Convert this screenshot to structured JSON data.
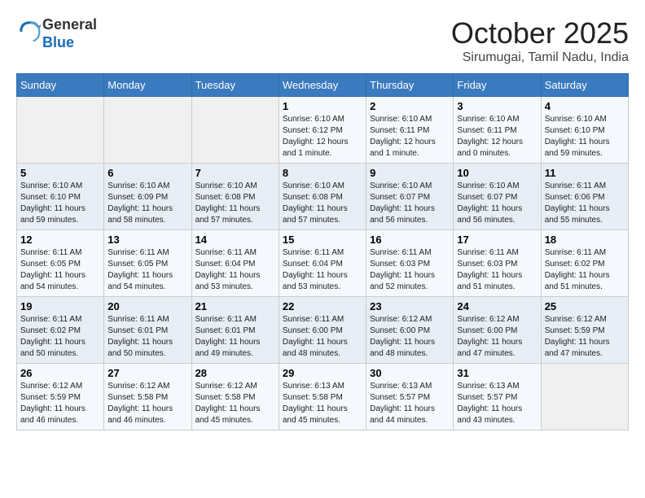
{
  "header": {
    "logo_line1": "General",
    "logo_line2": "Blue",
    "month": "October 2025",
    "location": "Sirumugai, Tamil Nadu, India"
  },
  "weekdays": [
    "Sunday",
    "Monday",
    "Tuesday",
    "Wednesday",
    "Thursday",
    "Friday",
    "Saturday"
  ],
  "weeks": [
    [
      {
        "day": "",
        "info": ""
      },
      {
        "day": "",
        "info": ""
      },
      {
        "day": "",
        "info": ""
      },
      {
        "day": "1",
        "info": "Sunrise: 6:10 AM\nSunset: 6:12 PM\nDaylight: 12 hours\nand 1 minute."
      },
      {
        "day": "2",
        "info": "Sunrise: 6:10 AM\nSunset: 6:11 PM\nDaylight: 12 hours\nand 1 minute."
      },
      {
        "day": "3",
        "info": "Sunrise: 6:10 AM\nSunset: 6:11 PM\nDaylight: 12 hours\nand 0 minutes."
      },
      {
        "day": "4",
        "info": "Sunrise: 6:10 AM\nSunset: 6:10 PM\nDaylight: 11 hours\nand 59 minutes."
      }
    ],
    [
      {
        "day": "5",
        "info": "Sunrise: 6:10 AM\nSunset: 6:10 PM\nDaylight: 11 hours\nand 59 minutes."
      },
      {
        "day": "6",
        "info": "Sunrise: 6:10 AM\nSunset: 6:09 PM\nDaylight: 11 hours\nand 58 minutes."
      },
      {
        "day": "7",
        "info": "Sunrise: 6:10 AM\nSunset: 6:08 PM\nDaylight: 11 hours\nand 57 minutes."
      },
      {
        "day": "8",
        "info": "Sunrise: 6:10 AM\nSunset: 6:08 PM\nDaylight: 11 hours\nand 57 minutes."
      },
      {
        "day": "9",
        "info": "Sunrise: 6:10 AM\nSunset: 6:07 PM\nDaylight: 11 hours\nand 56 minutes."
      },
      {
        "day": "10",
        "info": "Sunrise: 6:10 AM\nSunset: 6:07 PM\nDaylight: 11 hours\nand 56 minutes."
      },
      {
        "day": "11",
        "info": "Sunrise: 6:11 AM\nSunset: 6:06 PM\nDaylight: 11 hours\nand 55 minutes."
      }
    ],
    [
      {
        "day": "12",
        "info": "Sunrise: 6:11 AM\nSunset: 6:05 PM\nDaylight: 11 hours\nand 54 minutes."
      },
      {
        "day": "13",
        "info": "Sunrise: 6:11 AM\nSunset: 6:05 PM\nDaylight: 11 hours\nand 54 minutes."
      },
      {
        "day": "14",
        "info": "Sunrise: 6:11 AM\nSunset: 6:04 PM\nDaylight: 11 hours\nand 53 minutes."
      },
      {
        "day": "15",
        "info": "Sunrise: 6:11 AM\nSunset: 6:04 PM\nDaylight: 11 hours\nand 53 minutes."
      },
      {
        "day": "16",
        "info": "Sunrise: 6:11 AM\nSunset: 6:03 PM\nDaylight: 11 hours\nand 52 minutes."
      },
      {
        "day": "17",
        "info": "Sunrise: 6:11 AM\nSunset: 6:03 PM\nDaylight: 11 hours\nand 51 minutes."
      },
      {
        "day": "18",
        "info": "Sunrise: 6:11 AM\nSunset: 6:02 PM\nDaylight: 11 hours\nand 51 minutes."
      }
    ],
    [
      {
        "day": "19",
        "info": "Sunrise: 6:11 AM\nSunset: 6:02 PM\nDaylight: 11 hours\nand 50 minutes."
      },
      {
        "day": "20",
        "info": "Sunrise: 6:11 AM\nSunset: 6:01 PM\nDaylight: 11 hours\nand 50 minutes."
      },
      {
        "day": "21",
        "info": "Sunrise: 6:11 AM\nSunset: 6:01 PM\nDaylight: 11 hours\nand 49 minutes."
      },
      {
        "day": "22",
        "info": "Sunrise: 6:11 AM\nSunset: 6:00 PM\nDaylight: 11 hours\nand 48 minutes."
      },
      {
        "day": "23",
        "info": "Sunrise: 6:12 AM\nSunset: 6:00 PM\nDaylight: 11 hours\nand 48 minutes."
      },
      {
        "day": "24",
        "info": "Sunrise: 6:12 AM\nSunset: 6:00 PM\nDaylight: 11 hours\nand 47 minutes."
      },
      {
        "day": "25",
        "info": "Sunrise: 6:12 AM\nSunset: 5:59 PM\nDaylight: 11 hours\nand 47 minutes."
      }
    ],
    [
      {
        "day": "26",
        "info": "Sunrise: 6:12 AM\nSunset: 5:59 PM\nDaylight: 11 hours\nand 46 minutes."
      },
      {
        "day": "27",
        "info": "Sunrise: 6:12 AM\nSunset: 5:58 PM\nDaylight: 11 hours\nand 46 minutes."
      },
      {
        "day": "28",
        "info": "Sunrise: 6:12 AM\nSunset: 5:58 PM\nDaylight: 11 hours\nand 45 minutes."
      },
      {
        "day": "29",
        "info": "Sunrise: 6:13 AM\nSunset: 5:58 PM\nDaylight: 11 hours\nand 45 minutes."
      },
      {
        "day": "30",
        "info": "Sunrise: 6:13 AM\nSunset: 5:57 PM\nDaylight: 11 hours\nand 44 minutes."
      },
      {
        "day": "31",
        "info": "Sunrise: 6:13 AM\nSunset: 5:57 PM\nDaylight: 11 hours\nand 43 minutes."
      },
      {
        "day": "",
        "info": ""
      }
    ]
  ]
}
